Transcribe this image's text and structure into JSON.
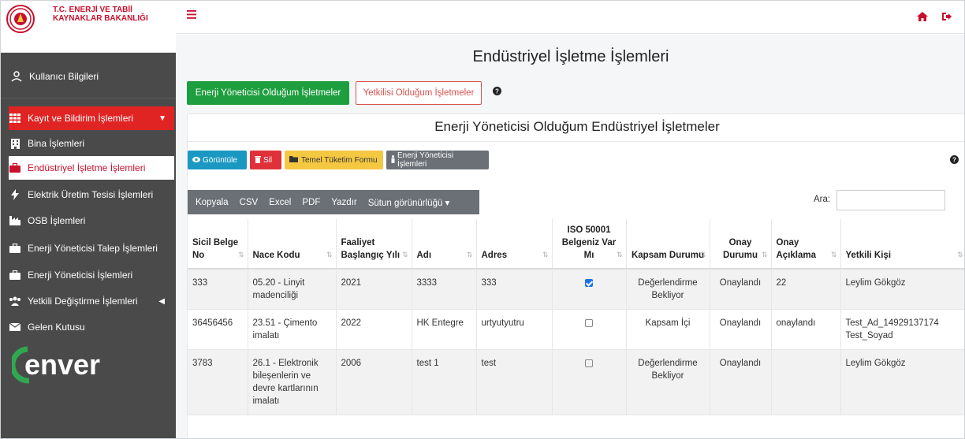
{
  "brand": {
    "line1": "T.C. ENERJİ VE TABİİ",
    "line2": "KAYNAKLAR BAKANLIĞI"
  },
  "sidebar": {
    "user": "Kullanıcı Bilgileri",
    "items": [
      {
        "label": "Kayıt ve Bildirim İşlemleri",
        "icon": "grid-icon",
        "expanded": true
      },
      {
        "label": "Bina İşlemleri",
        "icon": "building-icon"
      },
      {
        "label": "Endüstriyel İşletme İşlemleri",
        "icon": "briefcase-icon",
        "active": true
      },
      {
        "label": "Elektrik Üretim Tesisi İşlemleri",
        "icon": "bolt-icon"
      },
      {
        "label": "OSB İşlemleri",
        "icon": "industry-icon"
      },
      {
        "label": "Enerji Yöneticisi Talep İşlemleri",
        "icon": "briefcase-icon"
      },
      {
        "label": "Enerji Yöneticisi İşlemleri",
        "icon": "briefcase-icon"
      },
      {
        "label": "Yetkili Değiştirme İşlemleri",
        "icon": "users-icon"
      },
      {
        "label": "Gelen Kutusu",
        "icon": "envelope-icon"
      }
    ],
    "logo_text": "enver"
  },
  "page": {
    "title": "Endüstriyel İşletme İşlemleri",
    "tab_primary": "Enerji Yöneticisi Olduğum İşletmeler",
    "tab_secondary": "Yetkilisi Olduğum İşletmeler"
  },
  "panel": {
    "title": "Enerji Yöneticisi Olduğum Endüstriyel İşletmeler",
    "actions": {
      "view": "Görüntüle",
      "delete": "Sil",
      "form": "Temel Tüketim Formu",
      "manager": "Enerji Yöneticisi İşlemleri"
    },
    "dt_buttons": [
      "Kopyala",
      "CSV",
      "Excel",
      "PDF",
      "Yazdır",
      "Sütun görünürlüğü ▾"
    ],
    "search_label": "Ara:",
    "search_value": ""
  },
  "table": {
    "headers": [
      "Sicil Belge No",
      "Nace Kodu",
      "Faaliyet Başlangıç Yılı",
      "Adı",
      "Adres",
      "ISO 50001 Belgeniz Var Mı",
      "Kapsam Durumu",
      "Onay Durumu",
      "Onay Açıklama",
      "Yetkili Kişi"
    ],
    "rows": [
      {
        "sicil": "333",
        "nace": "05.20 - Linyit madenciliği",
        "yil": "2021",
        "adi": "3333",
        "adres": "333",
        "iso": true,
        "kapsam": "Değerlendirme Bekliyor",
        "onay": "Onaylandı",
        "aciklama": "22",
        "yetkili": "Leylim Gökgöz"
      },
      {
        "sicil": "36456456",
        "nace": "23.51 - Çimento imalatı",
        "yil": "2022",
        "adi": "HK Entegre",
        "adres": "urtyutyutru",
        "iso": false,
        "kapsam": "Kapsam İçi",
        "onay": "Onaylandı",
        "aciklama": "onaylandı",
        "yetkili": "Test_Ad_14929137174 Test_Soyad"
      },
      {
        "sicil": "3783",
        "nace": "26.1 - Elektronik bileşenlerin ve devre kartlarının imalatı",
        "yil": "2006",
        "adi": "test 1",
        "adres": "test",
        "iso": false,
        "kapsam": "Değerlendirme Bekliyor",
        "onay": "Onaylandı",
        "aciklama": "",
        "yetkili": "Leylim Gökgöz"
      }
    ]
  },
  "colors": {
    "sidebar": "#4a4a4a",
    "active_red": "#e02323",
    "green": "#1e9e3e",
    "brand_red": "#c8102e"
  }
}
